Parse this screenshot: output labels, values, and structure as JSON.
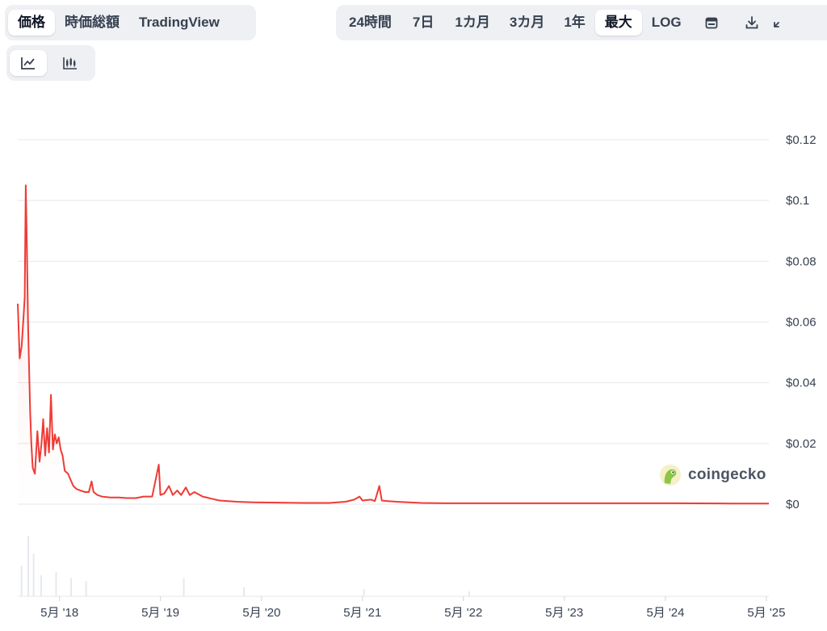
{
  "toolbar_left": {
    "tabs": [
      {
        "label": "価格",
        "active": true
      },
      {
        "label": "時価総額",
        "active": false
      },
      {
        "label": "TradingView",
        "active": false
      }
    ]
  },
  "toolbar_right": {
    "ranges": [
      {
        "label": "24時間",
        "active": false
      },
      {
        "label": "7日",
        "active": false
      },
      {
        "label": "1カ月",
        "active": false
      },
      {
        "label": "3カ月",
        "active": false
      },
      {
        "label": "1年",
        "active": false
      },
      {
        "label": "最大",
        "active": true
      },
      {
        "label": "LOG",
        "active": false
      }
    ],
    "icons": [
      "calendar-icon",
      "download-icon",
      "expand-icon"
    ]
  },
  "chart_type_toggle": {
    "icons": [
      "line-chart-icon",
      "candlestick-chart-icon"
    ],
    "active": "line-chart-icon"
  },
  "brand": {
    "text": "coingecko"
  },
  "colors": {
    "line": "#ef3b36",
    "grid": "#e5e7eb",
    "toolbar_bg": "#eef0f3",
    "brand_green": "#8dc647"
  },
  "chart_data": {
    "type": "line",
    "title": "",
    "xlabel": "",
    "ylabel": "",
    "ylim": [
      0,
      0.12
    ],
    "y_ticks": [
      {
        "value": 0.12,
        "label": "$0.12"
      },
      {
        "value": 0.1,
        "label": "$0.1"
      },
      {
        "value": 0.08,
        "label": "$0.08"
      },
      {
        "value": 0.06,
        "label": "$0.06"
      },
      {
        "value": 0.04,
        "label": "$0.04"
      },
      {
        "value": 0.02,
        "label": "$0.02"
      },
      {
        "value": 0,
        "label": "$0"
      }
    ],
    "x_range": [
      "2017-12-01",
      "2025-05-10"
    ],
    "x_ticks": [
      {
        "date": "2018-05-01",
        "label": "5月 '18"
      },
      {
        "date": "2019-05-01",
        "label": "5月 '19"
      },
      {
        "date": "2020-05-01",
        "label": "5月 '20"
      },
      {
        "date": "2021-05-01",
        "label": "5月 '21"
      },
      {
        "date": "2022-05-01",
        "label": "5月 '22"
      },
      {
        "date": "2023-05-01",
        "label": "5月 '23"
      },
      {
        "date": "2024-05-01",
        "label": "5月 '24"
      },
      {
        "date": "2025-05-01",
        "label": "5月 '25"
      }
    ],
    "grid": true,
    "series": [
      {
        "points": [
          [
            "2017-12-01",
            0.066
          ],
          [
            "2017-12-08",
            0.048
          ],
          [
            "2017-12-15",
            0.052
          ],
          [
            "2017-12-22",
            0.062
          ],
          [
            "2017-12-26",
            0.068
          ],
          [
            "2017-12-30",
            0.105
          ],
          [
            "2018-01-03",
            0.085
          ],
          [
            "2018-01-07",
            0.06
          ],
          [
            "2018-01-11",
            0.045
          ],
          [
            "2018-01-15",
            0.03
          ],
          [
            "2018-01-19",
            0.02
          ],
          [
            "2018-01-24",
            0.012
          ],
          [
            "2018-02-01",
            0.01
          ],
          [
            "2018-02-10",
            0.024
          ],
          [
            "2018-02-18",
            0.014
          ],
          [
            "2018-02-25",
            0.02
          ],
          [
            "2018-03-03",
            0.028
          ],
          [
            "2018-03-10",
            0.016
          ],
          [
            "2018-03-17",
            0.025
          ],
          [
            "2018-03-24",
            0.017
          ],
          [
            "2018-03-31",
            0.036
          ],
          [
            "2018-04-07",
            0.018
          ],
          [
            "2018-04-14",
            0.023
          ],
          [
            "2018-04-21",
            0.02
          ],
          [
            "2018-04-28",
            0.022
          ],
          [
            "2018-05-05",
            0.018
          ],
          [
            "2018-05-12",
            0.016
          ],
          [
            "2018-05-20",
            0.011
          ],
          [
            "2018-06-01",
            0.01
          ],
          [
            "2018-06-10",
            0.008
          ],
          [
            "2018-06-20",
            0.006
          ],
          [
            "2018-07-01",
            0.005
          ],
          [
            "2018-07-15",
            0.0045
          ],
          [
            "2018-08-01",
            0.004
          ],
          [
            "2018-08-15",
            0.004
          ],
          [
            "2018-08-25",
            0.0075
          ],
          [
            "2018-09-01",
            0.004
          ],
          [
            "2018-09-15",
            0.003
          ],
          [
            "2018-10-01",
            0.0025
          ],
          [
            "2018-11-01",
            0.0022
          ],
          [
            "2018-12-01",
            0.0022
          ],
          [
            "2019-01-01",
            0.002
          ],
          [
            "2019-02-01",
            0.002
          ],
          [
            "2019-03-01",
            0.0025
          ],
          [
            "2019-04-01",
            0.0025
          ],
          [
            "2019-04-25",
            0.013
          ],
          [
            "2019-05-01",
            0.003
          ],
          [
            "2019-05-15",
            0.0035
          ],
          [
            "2019-06-01",
            0.006
          ],
          [
            "2019-06-15",
            0.003
          ],
          [
            "2019-07-01",
            0.0045
          ],
          [
            "2019-07-15",
            0.003
          ],
          [
            "2019-08-01",
            0.0055
          ],
          [
            "2019-08-15",
            0.003
          ],
          [
            "2019-09-01",
            0.004
          ],
          [
            "2019-10-01",
            0.0025
          ],
          [
            "2019-11-01",
            0.0018
          ],
          [
            "2019-12-01",
            0.0012
          ],
          [
            "2020-01-01",
            0.001
          ],
          [
            "2020-02-01",
            0.0008
          ],
          [
            "2020-04-01",
            0.0006
          ],
          [
            "2020-07-01",
            0.0005
          ],
          [
            "2020-10-01",
            0.0004
          ],
          [
            "2021-01-01",
            0.0004
          ],
          [
            "2021-03-01",
            0.0008
          ],
          [
            "2021-04-01",
            0.0015
          ],
          [
            "2021-04-20",
            0.0025
          ],
          [
            "2021-05-01",
            0.0012
          ],
          [
            "2021-06-01",
            0.0015
          ],
          [
            "2021-06-15",
            0.001
          ],
          [
            "2021-07-01",
            0.006
          ],
          [
            "2021-07-10",
            0.0012
          ],
          [
            "2021-08-01",
            0.001
          ],
          [
            "2021-09-01",
            0.0008
          ],
          [
            "2021-12-01",
            0.0004
          ],
          [
            "2022-03-01",
            0.0003
          ],
          [
            "2022-06-01",
            0.0003
          ],
          [
            "2023-01-01",
            0.0003
          ],
          [
            "2023-06-01",
            0.0003
          ],
          [
            "2024-01-01",
            0.0003
          ],
          [
            "2024-06-01",
            0.0003
          ],
          [
            "2025-01-01",
            0.0002
          ],
          [
            "2025-05-10",
            0.0002
          ]
        ]
      }
    ]
  }
}
